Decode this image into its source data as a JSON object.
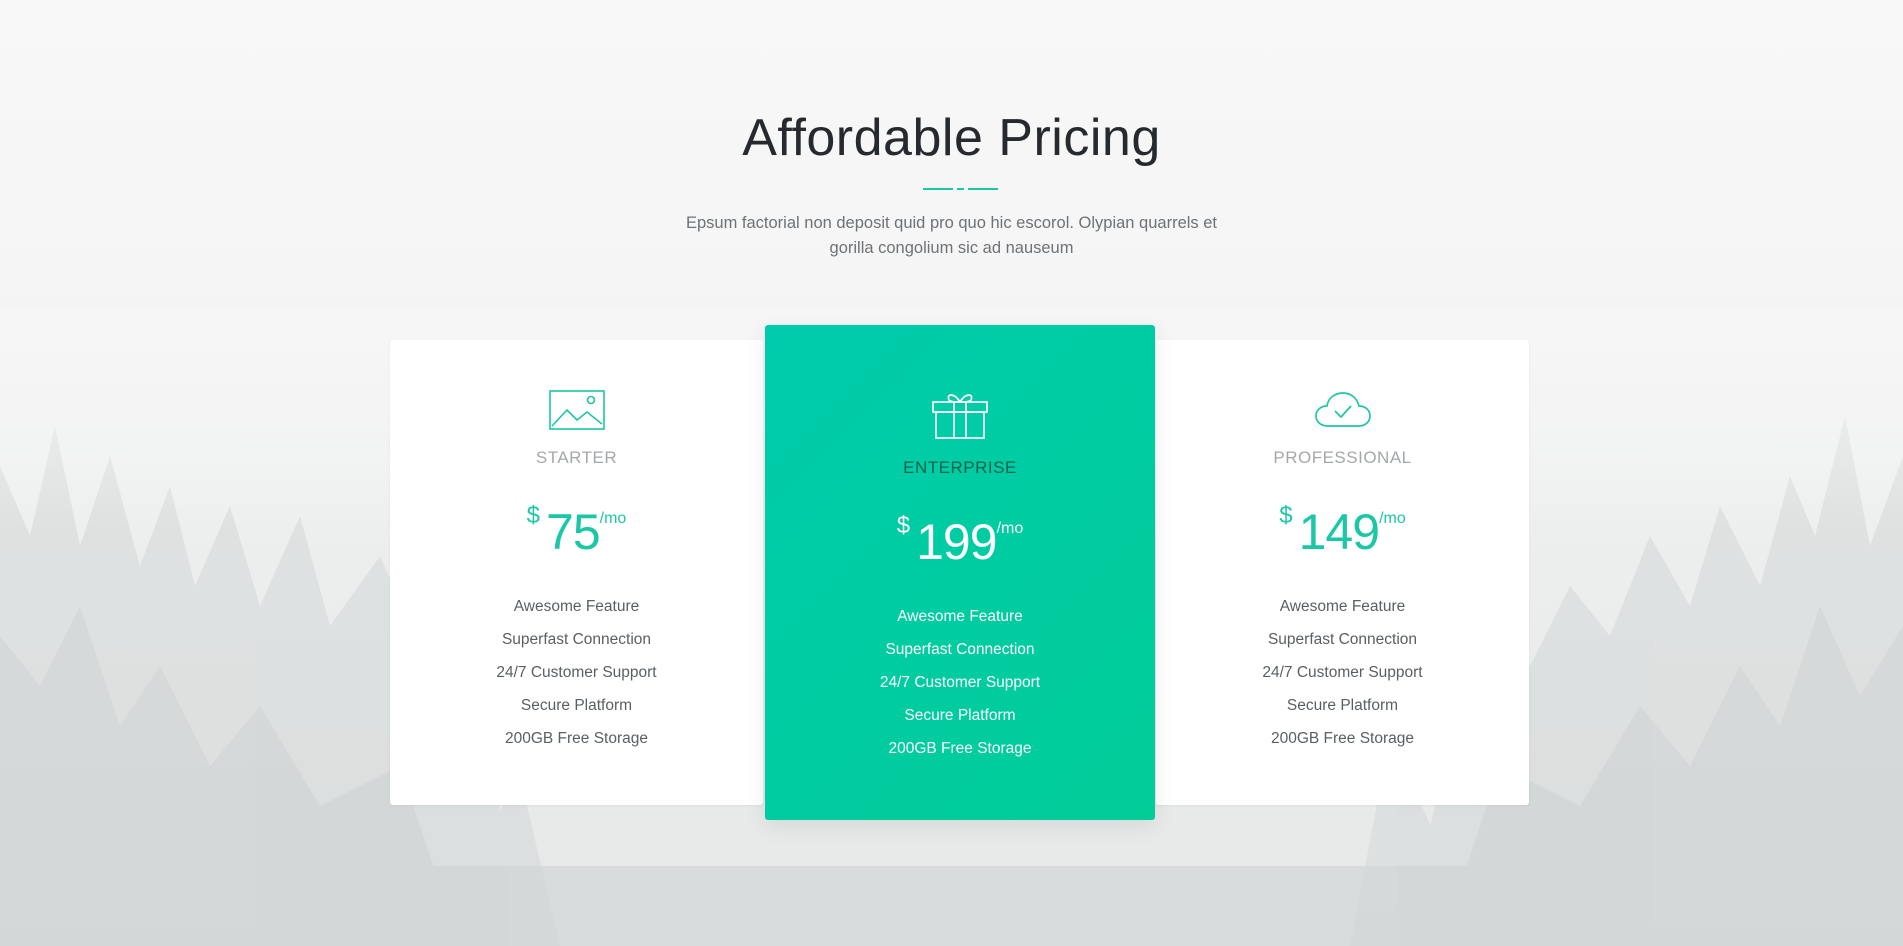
{
  "section": {
    "title": "Affordable Pricing",
    "subtitle_lines": [
      "Epsum factorial non deposit quid pro quo hic escorol. Olypian quarrels et",
      "gorilla congolium sic ad nauseum"
    ]
  },
  "colors": {
    "accent": "#1bc7a4",
    "featured_gradient_start": "#00cbac",
    "featured_gradient_end": "#00cd98"
  },
  "plans": [
    {
      "icon": "image-icon",
      "name": "STARTER",
      "currency": "$",
      "amount": "75",
      "period": "/mo",
      "features": [
        "Awesome Feature",
        "Superfast Connection",
        "24/7 Customer Support",
        "Secure Platform",
        "200GB Free Storage"
      ]
    },
    {
      "icon": "gift-icon",
      "name": "ENTERPRISE",
      "currency": "$",
      "amount": "199",
      "period": "/mo",
      "features": [
        "Awesome Feature",
        "Superfast Connection",
        "24/7 Customer Support",
        "Secure Platform",
        "200GB Free Storage"
      ]
    },
    {
      "icon": "cloud-check-icon",
      "name": "PROFESSIONAL",
      "currency": "$",
      "amount": "149",
      "period": "/mo",
      "features": [
        "Awesome Feature",
        "Superfast Connection",
        "24/7 Customer Support",
        "Secure Platform",
        "200GB Free Storage"
      ]
    }
  ]
}
